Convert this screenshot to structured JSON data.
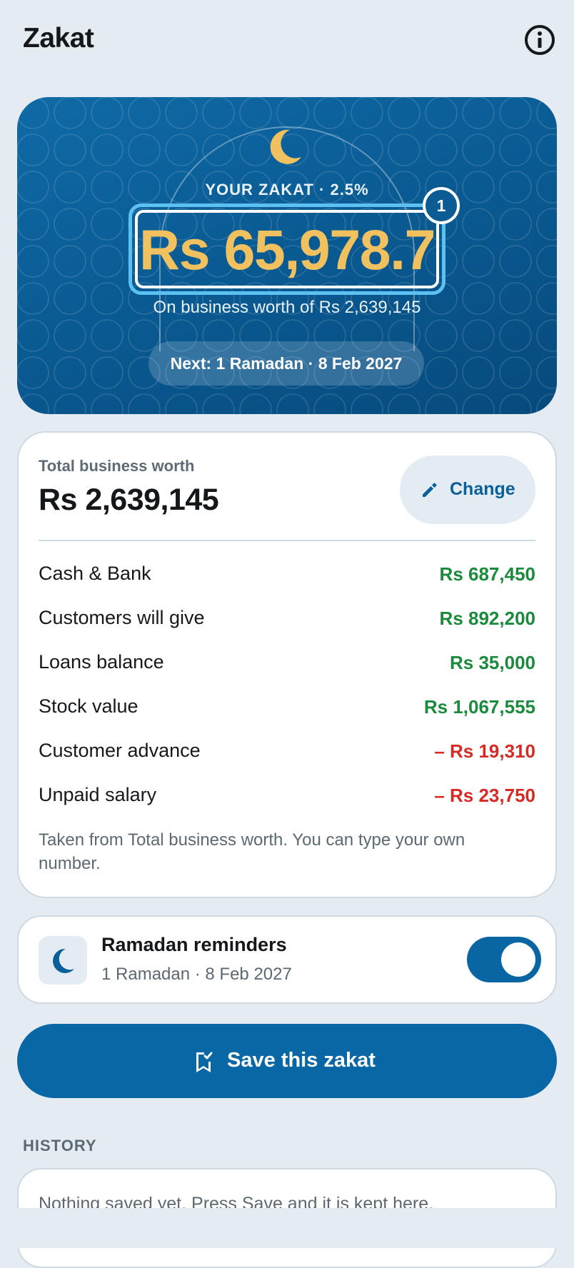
{
  "header": {
    "title": "Zakat",
    "info_icon": "info-icon"
  },
  "hero": {
    "moon_icon": "crescent-moon-icon",
    "label": "YOUR ZAKAT · 2.5%",
    "amount": "Rs 65,978.7",
    "badge": "1",
    "worth_line": "On business worth of Rs 2,639,145",
    "next_pill": "Next: 1 Ramadan · 8 Feb 2027",
    "colors": {
      "accent": "#f2c15f",
      "highlight": "#5cc0f0",
      "background": "#0a5a92"
    }
  },
  "worth": {
    "label": "Total business worth",
    "value": "Rs 2,639,145",
    "change_label": "Change",
    "change_icon": "pencil-icon",
    "rows": [
      {
        "label": "Cash & Bank",
        "value": "Rs 687,450",
        "kind": "positive"
      },
      {
        "label": "Customers will give",
        "value": "Rs 892,200",
        "kind": "positive"
      },
      {
        "label": "Loans balance",
        "value": "Rs 35,000",
        "kind": "positive"
      },
      {
        "label": "Stock value",
        "value": "Rs 1,067,555",
        "kind": "positive"
      },
      {
        "label": "Customer advance",
        "value": "– Rs 19,310",
        "kind": "negative"
      },
      {
        "label": "Unpaid salary",
        "value": "– Rs 23,750",
        "kind": "negative"
      }
    ],
    "note": "Taken from Total business worth. You can type your own number.",
    "colors": {
      "positive": "#1a8a3c",
      "negative": "#d72a25"
    }
  },
  "reminders": {
    "icon": "crescent-moon-icon",
    "title": "Ramadan reminders",
    "subtitle": "1 Ramadan · 8 Feb 2027",
    "enabled": true
  },
  "save": {
    "label": "Save this zakat",
    "icon": "bookmark-check-icon"
  },
  "history": {
    "heading": "HISTORY",
    "empty_text": "Nothing saved yet. Press Save and it is kept here."
  }
}
